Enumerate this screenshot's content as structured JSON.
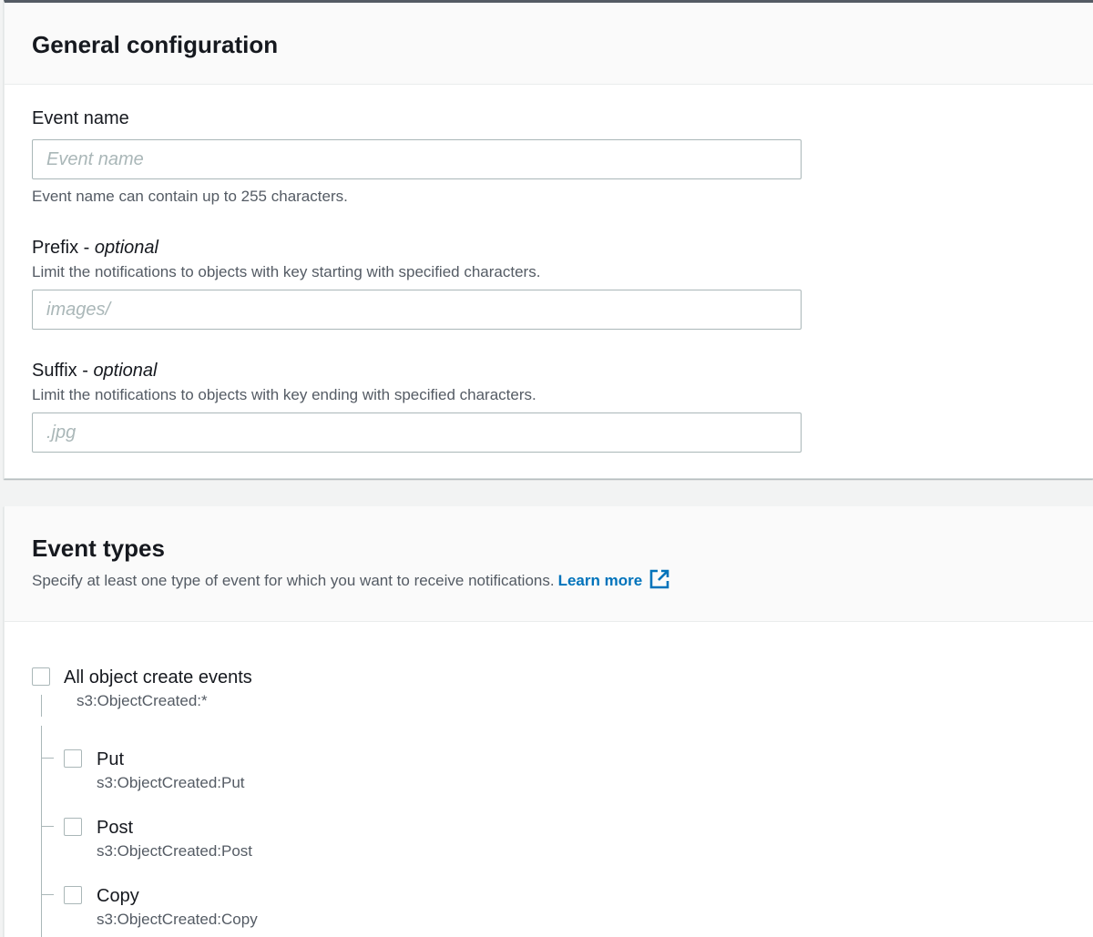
{
  "general_config": {
    "title": "General configuration",
    "event_name": {
      "label": "Event name",
      "placeholder": "Event name",
      "value": "",
      "hint": "Event name can contain up to 255 characters."
    },
    "prefix": {
      "label": "Prefix - ",
      "optional": "optional",
      "description": "Limit the notifications to objects with key starting with specified characters.",
      "placeholder": "images/",
      "value": ""
    },
    "suffix": {
      "label": "Suffix - ",
      "optional": "optional",
      "description": "Limit the notifications to objects with key ending with specified characters.",
      "placeholder": ".jpg",
      "value": ""
    }
  },
  "event_types": {
    "title": "Event types",
    "description": "Specify at least one type of event for which you want to receive notifications.",
    "learn_more": "Learn more",
    "link_color": "#0073bb",
    "all_create": {
      "label": "All object create events",
      "code": "s3:ObjectCreated:*",
      "checked": false
    },
    "options": [
      {
        "label": "Put",
        "code": "s3:ObjectCreated:Put",
        "checked": false
      },
      {
        "label": "Post",
        "code": "s3:ObjectCreated:Post",
        "checked": false
      },
      {
        "label": "Copy",
        "code": "s3:ObjectCreated:Copy",
        "checked": false
      }
    ]
  }
}
